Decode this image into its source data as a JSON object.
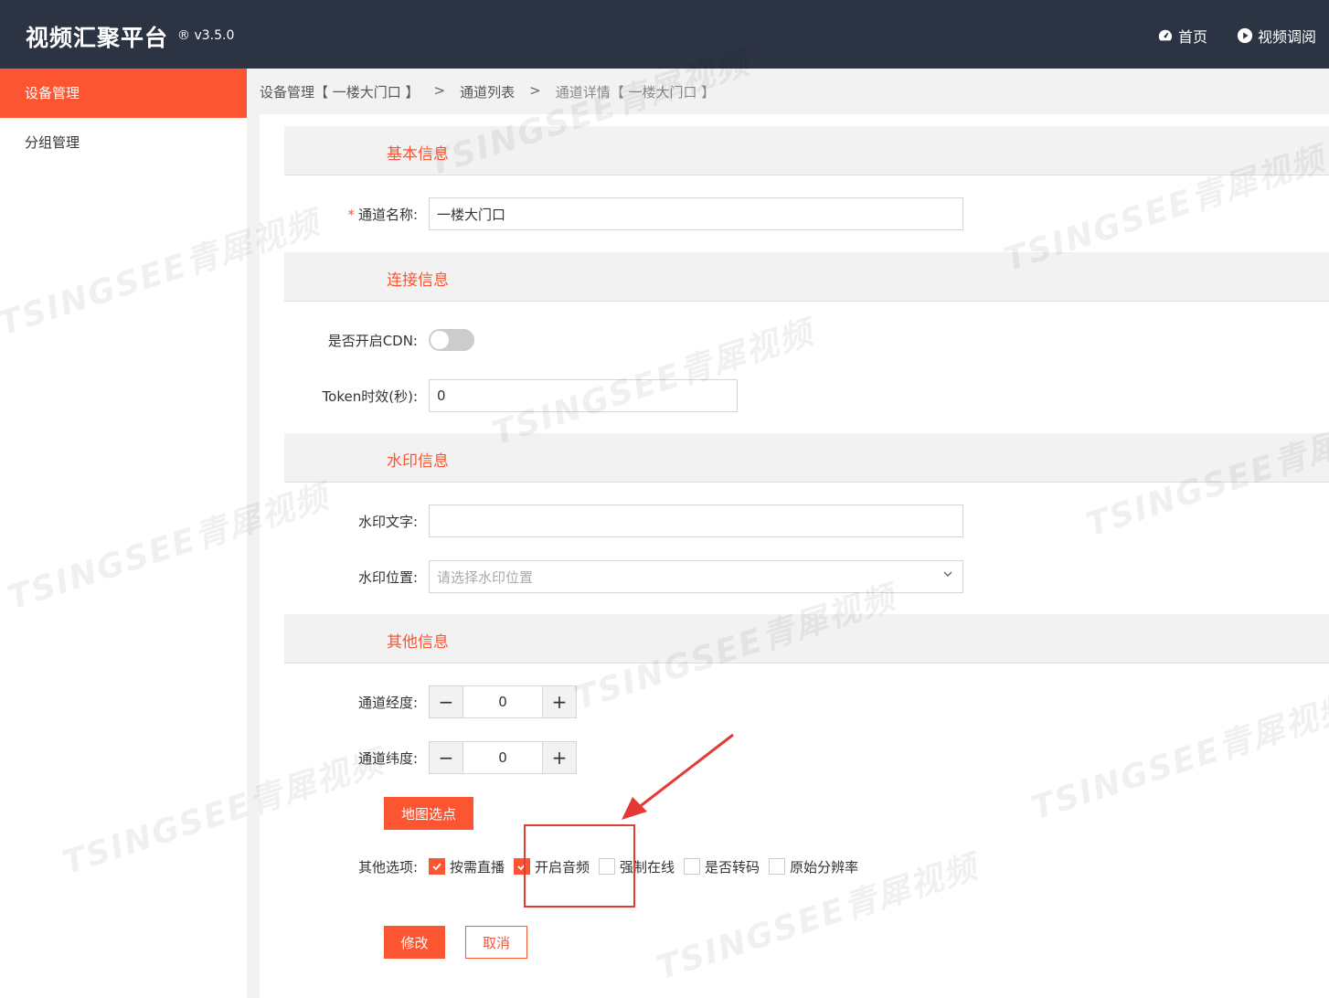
{
  "header": {
    "title": "视频汇聚平台",
    "version": "® v3.5.0",
    "nav": [
      {
        "label": "首页",
        "icon": "dashboard-icon"
      },
      {
        "label": "视频调阅",
        "icon": "play-circle-icon"
      }
    ]
  },
  "sidebar": {
    "items": [
      {
        "label": "设备管理",
        "active": true
      },
      {
        "label": "分组管理",
        "active": false
      }
    ]
  },
  "breadcrumb": {
    "items": [
      "设备管理【 一楼大门口 】",
      "通道列表",
      "通道详情【 一楼大门口 】"
    ],
    "separator": ">"
  },
  "sections": {
    "basic": "基本信息",
    "connection": "连接信息",
    "watermark": "水印信息",
    "other": "其他信息"
  },
  "form": {
    "channel_name": {
      "label": "通道名称:",
      "required_mark": "*",
      "value": "一楼大门口"
    },
    "cdn": {
      "label": "是否开启CDN:",
      "enabled": false
    },
    "token": {
      "label": "Token时效(秒):",
      "value": "0"
    },
    "watermark_text": {
      "label": "水印文字:",
      "value": ""
    },
    "watermark_position": {
      "label": "水印位置:",
      "placeholder": "请选择水印位置"
    },
    "longitude": {
      "label": "通道经度:",
      "value": "0",
      "minus": "−",
      "plus": "+"
    },
    "latitude": {
      "label": "通道纬度:",
      "value": "0",
      "minus": "−",
      "plus": "+"
    },
    "map_button": "地图选点",
    "options_label": "其他选项:",
    "options": [
      {
        "label": "按需直播",
        "checked": true
      },
      {
        "label": "开启音频",
        "checked": true
      },
      {
        "label": "强制在线",
        "checked": false
      },
      {
        "label": "是否转码",
        "checked": false
      },
      {
        "label": "原始分辨率",
        "checked": false
      }
    ],
    "submit": "修改",
    "cancel": "取消"
  },
  "watermark_overlay": "TSINGSEE青犀视频",
  "colors": {
    "accent": "#fc5531",
    "topbar": "#2c3444",
    "annotation": "#e53935"
  }
}
